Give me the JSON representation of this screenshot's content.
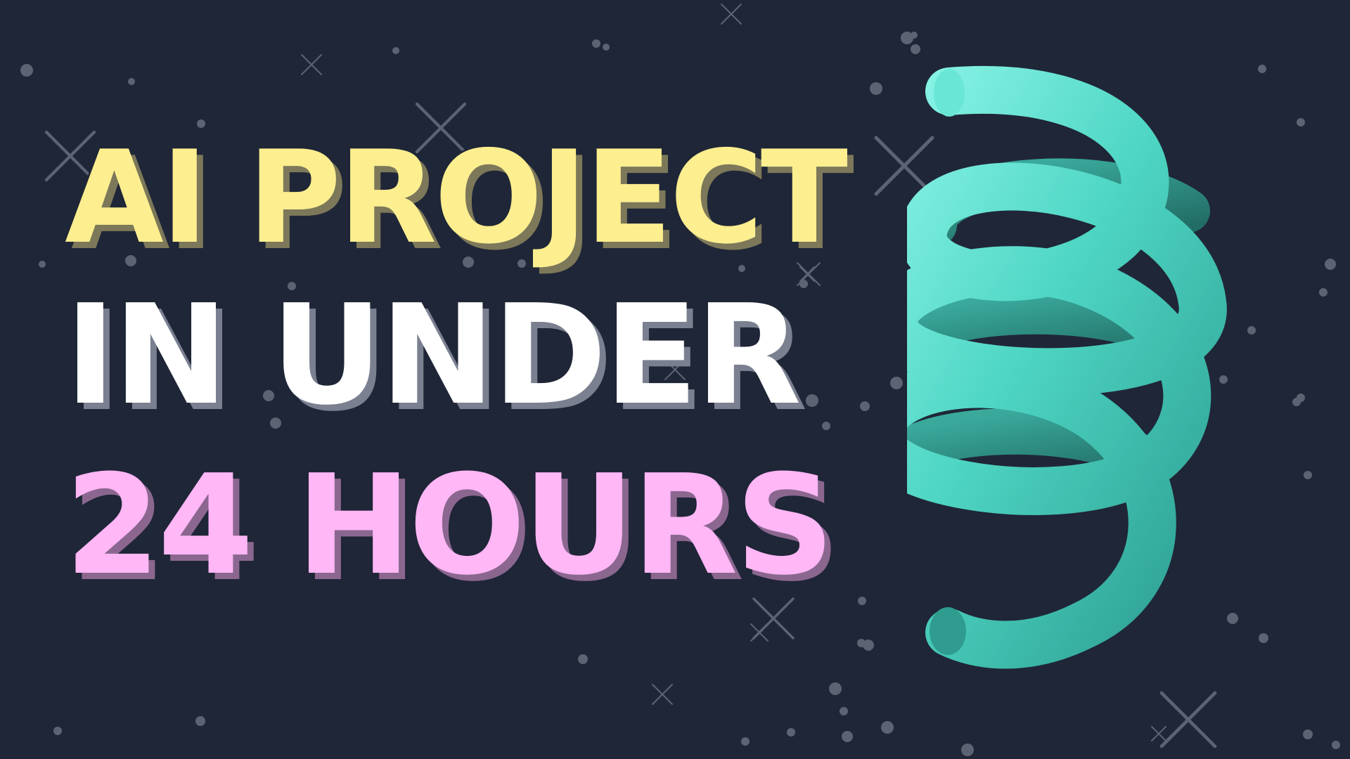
{
  "headline": {
    "line1": "AI PROJECT",
    "line2": "IN UNDER",
    "line3": "24 HOURS"
  },
  "colors": {
    "background": "#1f2637",
    "line1_fill": "#fdee8f",
    "line1_shadow": "#7c7859",
    "line2_fill": "#ffffff",
    "line2_shadow": "#7a8090",
    "line3_fill": "#ffb7f6",
    "line3_shadow": "#8b6790",
    "spring": "#4fd6c4",
    "star": "#5c6373"
  },
  "decorations": {
    "spring": "coil-spring-3d",
    "background": "starfield"
  }
}
